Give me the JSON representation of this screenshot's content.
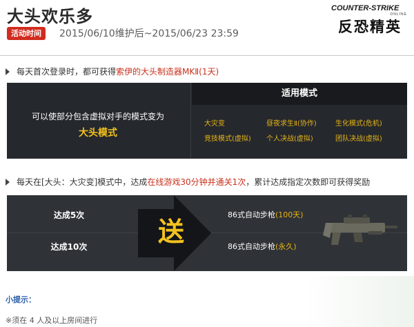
{
  "header": {
    "title": "大头欢乐多",
    "date_badge": "活动时间",
    "date_range": "2015/06/10维护后~2015/06/23 23:59",
    "logo_en": "COUNTER-STRIKE",
    "logo_online": "ONLINE",
    "logo_cn": "反恐精英"
  },
  "section1": {
    "prefix": "每天首次登录时，都可获得",
    "highlight": "索伊的大头制造器MKⅡ(1天)"
  },
  "modes": {
    "description": "可以使部分包含虚拟对手的模式变为",
    "mode_name": "大头模式",
    "header": "适用模式",
    "items": [
      "大灾变",
      "昼夜求生Ⅱ(协作)",
      "生化模式(危机)",
      "竞技模式(虚拟)",
      "个人决战(虚拟)",
      "团队决战(虚拟)"
    ]
  },
  "section2": {
    "prefix": "每天在[大头：大灾变]模式中，达成",
    "highlight": "在线游戏30分钟并通关1次",
    "suffix": "，累计达成指定次数即可获得奖励"
  },
  "rewards": {
    "send_label": "送",
    "rows": [
      {
        "count": "达成5次",
        "item": "86式自动步枪",
        "duration": "(100天)"
      },
      {
        "count": "达成10次",
        "item": "86式自动步枪",
        "duration": "(永久)"
      }
    ]
  },
  "tips": {
    "title": "小提示：",
    "text": "※须在 4 人及以上房间进行"
  },
  "colors": {
    "accent_red": "#d12c1e",
    "highlight_gold": "#f2c21f",
    "panel_dark": "#25282d"
  }
}
